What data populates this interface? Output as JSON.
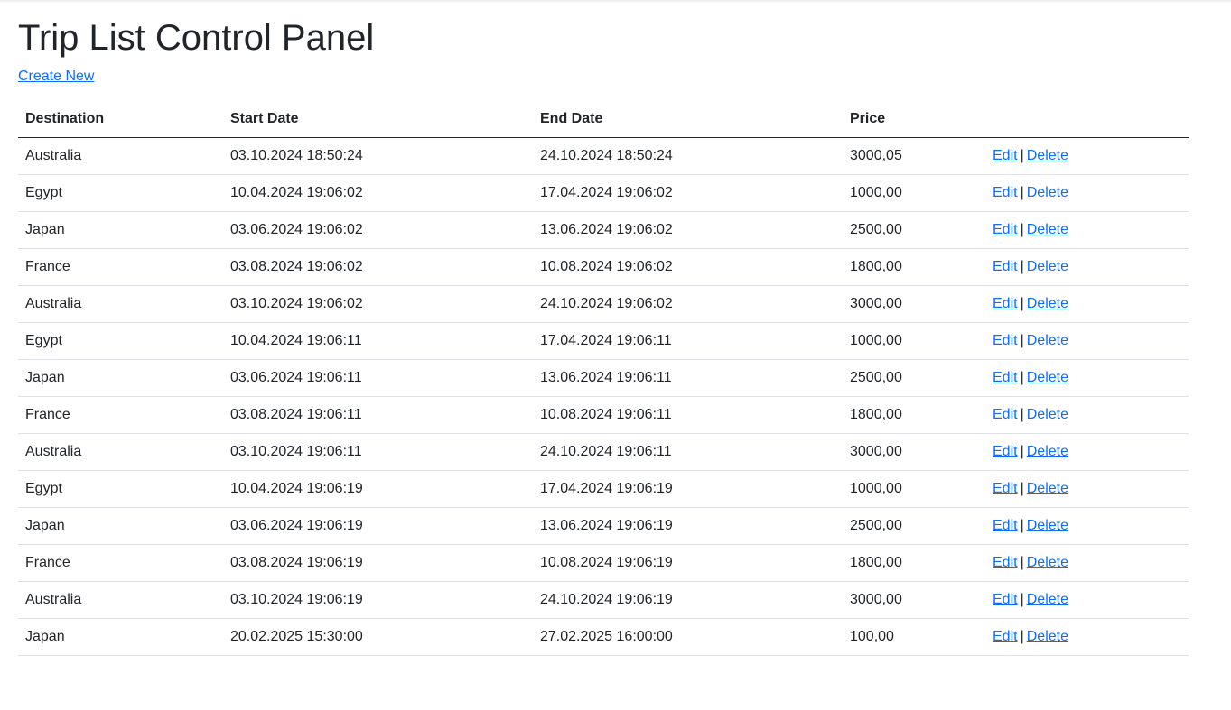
{
  "page": {
    "title": "Trip List Control Panel",
    "create_label": "Create New"
  },
  "table": {
    "headers": [
      "Destination",
      "Start Date",
      "End Date",
      "Price",
      ""
    ],
    "edit_label": "Edit",
    "delete_label": "Delete",
    "separator": "|",
    "rows": [
      {
        "destination": "Australia",
        "start": "03.10.2024 18:50:24",
        "end": "24.10.2024 18:50:24",
        "price": "3000,05"
      },
      {
        "destination": "Egypt",
        "start": "10.04.2024 19:06:02",
        "end": "17.04.2024 19:06:02",
        "price": "1000,00"
      },
      {
        "destination": "Japan",
        "start": "03.06.2024 19:06:02",
        "end": "13.06.2024 19:06:02",
        "price": "2500,00"
      },
      {
        "destination": "France",
        "start": "03.08.2024 19:06:02",
        "end": "10.08.2024 19:06:02",
        "price": "1800,00"
      },
      {
        "destination": "Australia",
        "start": "03.10.2024 19:06:02",
        "end": "24.10.2024 19:06:02",
        "price": "3000,00"
      },
      {
        "destination": "Egypt",
        "start": "10.04.2024 19:06:11",
        "end": "17.04.2024 19:06:11",
        "price": "1000,00"
      },
      {
        "destination": "Japan",
        "start": "03.06.2024 19:06:11",
        "end": "13.06.2024 19:06:11",
        "price": "2500,00"
      },
      {
        "destination": "France",
        "start": "03.08.2024 19:06:11",
        "end": "10.08.2024 19:06:11",
        "price": "1800,00"
      },
      {
        "destination": "Australia",
        "start": "03.10.2024 19:06:11",
        "end": "24.10.2024 19:06:11",
        "price": "3000,00"
      },
      {
        "destination": "Egypt",
        "start": "10.04.2024 19:06:19",
        "end": "17.04.2024 19:06:19",
        "price": "1000,00"
      },
      {
        "destination": "Japan",
        "start": "03.06.2024 19:06:19",
        "end": "13.06.2024 19:06:19",
        "price": "2500,00"
      },
      {
        "destination": "France",
        "start": "03.08.2024 19:06:19",
        "end": "10.08.2024 19:06:19",
        "price": "1800,00"
      },
      {
        "destination": "Australia",
        "start": "03.10.2024 19:06:19",
        "end": "24.10.2024 19:06:19",
        "price": "3000,00"
      },
      {
        "destination": "Japan",
        "start": "20.02.2025 15:30:00",
        "end": "27.02.2025 16:00:00",
        "price": "100,00"
      }
    ]
  },
  "colors": {
    "link": "#0d6efd",
    "text": "#212529",
    "row_border": "#dee2e6"
  }
}
